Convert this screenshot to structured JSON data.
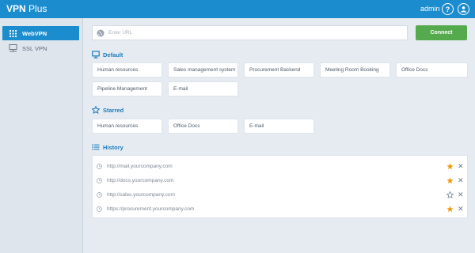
{
  "header": {
    "brand_bold": "VPN",
    "brand_light": " Plus",
    "user": "admin",
    "help_label": "?",
    "colors": {
      "bar": "#1b8ccd",
      "text": "#ffffff"
    }
  },
  "sidebar": {
    "items": [
      {
        "label": "WebVPN",
        "icon": "grid-icon",
        "active": true
      },
      {
        "label": "SSL VPN",
        "icon": "monitor-network-icon",
        "active": false
      }
    ]
  },
  "url_bar": {
    "placeholder": "Enter URL",
    "value": "",
    "icon": "globe-icon",
    "connect_label": "Connect",
    "connect_color": "#56aa4e"
  },
  "default_section": {
    "title": "Default",
    "icon": "monitor-icon",
    "items": [
      "Human resources",
      "Sales management system",
      "Procurement Backend",
      "Meeting Room Booking",
      "Office Docs",
      "Pipeline Management",
      "E-mail"
    ]
  },
  "starred_section": {
    "title": "Starred",
    "icon": "star-outline-icon",
    "items": [
      "Human resources",
      "Office Docs",
      "E-mail"
    ]
  },
  "history_section": {
    "title": "History",
    "icon": "list-icon",
    "items": [
      {
        "url": "http://mail.yourcompany.com",
        "starred": true
      },
      {
        "url": "http://docs.yourcompany.com",
        "starred": true
      },
      {
        "url": "http://sales.yourcompany.com",
        "starred": false
      },
      {
        "url": "https://procurement.yourcompany.com",
        "starred": true
      }
    ],
    "star_color": "#f39c12",
    "remove_label": "✕"
  }
}
